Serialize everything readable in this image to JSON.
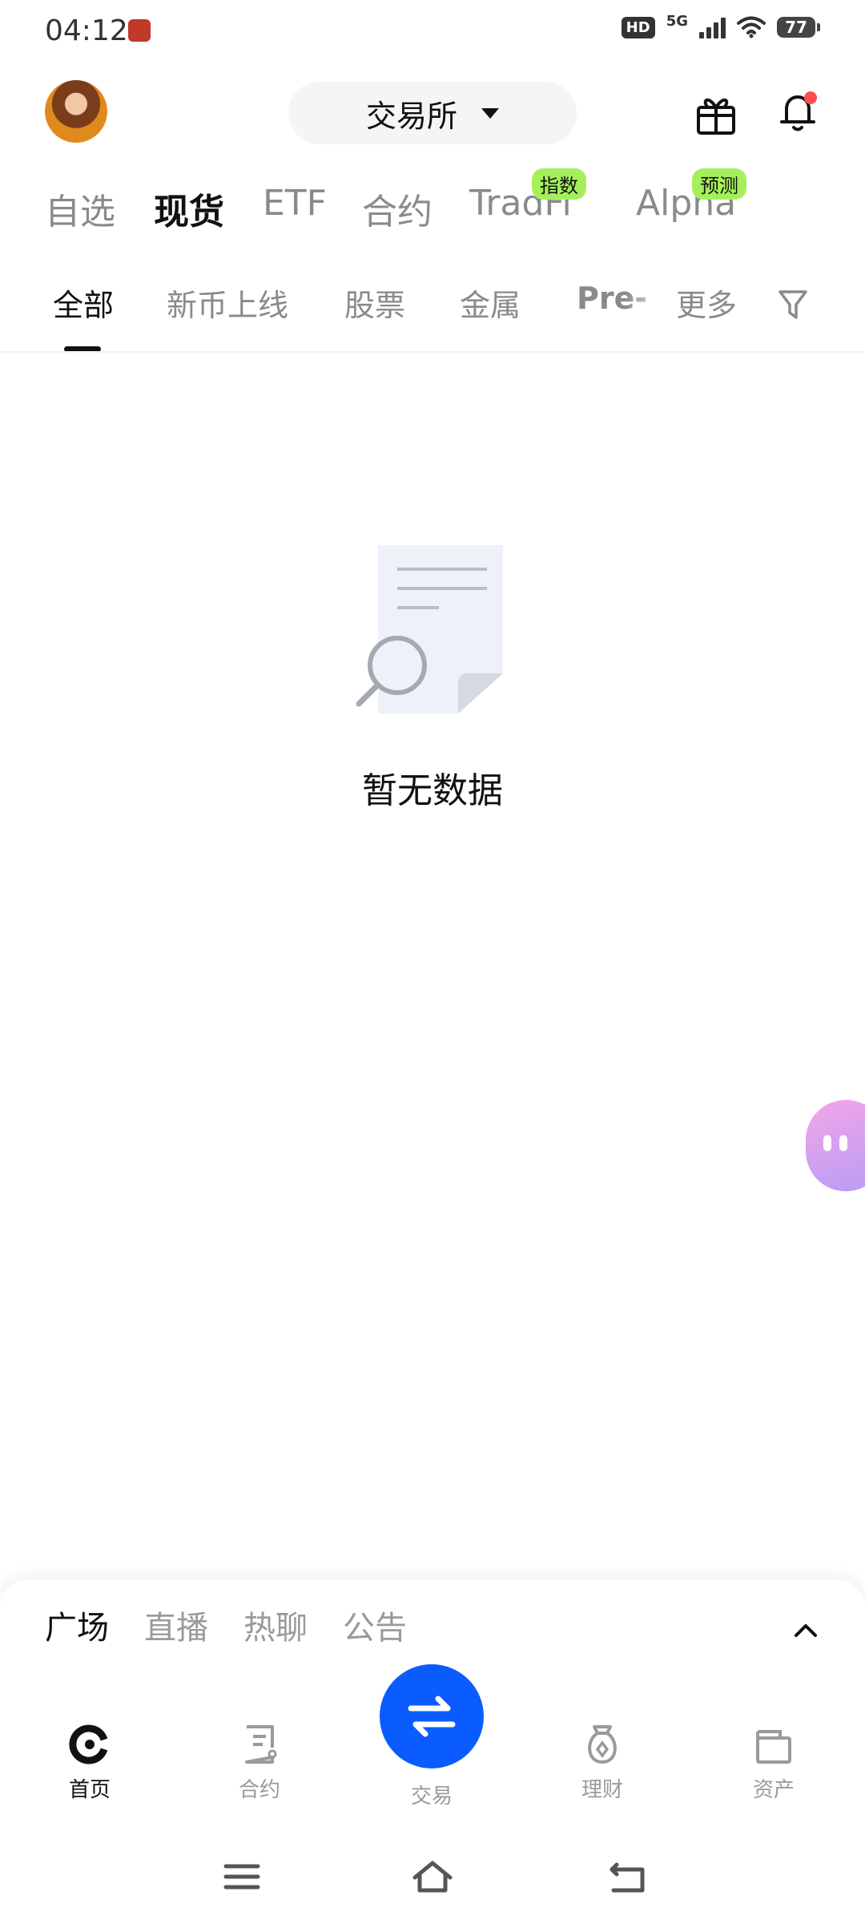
{
  "status_bar": {
    "time": "04:12",
    "hd": "HD",
    "network": "5G",
    "battery": "77"
  },
  "header": {
    "exchange_label": "交易所"
  },
  "main_tabs": [
    {
      "label": "自选",
      "badge": ""
    },
    {
      "label": "现货",
      "badge": "",
      "active": true
    },
    {
      "label": "ETF",
      "badge": ""
    },
    {
      "label": "合约",
      "badge": ""
    },
    {
      "label": "TradFi",
      "badge": "指数"
    },
    {
      "label": "Alpha",
      "badge": "预测"
    }
  ],
  "sub_tabs": [
    {
      "label": "全部",
      "active": true
    },
    {
      "label": "新币上线"
    },
    {
      "label": "股票"
    },
    {
      "label": "金属"
    },
    {
      "label": "Pre-M"
    },
    {
      "label": "更多"
    }
  ],
  "empty_state": {
    "text": "暂无数据"
  },
  "feed_tabs": [
    {
      "label": "广场",
      "active": true
    },
    {
      "label": "直播"
    },
    {
      "label": "热聊"
    },
    {
      "label": "公告"
    }
  ],
  "bottom_nav": [
    {
      "label": "首页",
      "icon": "home-icon",
      "active": true
    },
    {
      "label": "合约",
      "icon": "contract-icon"
    },
    {
      "label": "交易",
      "icon": "swap-icon"
    },
    {
      "label": "理财",
      "icon": "earn-icon"
    },
    {
      "label": "资产",
      "icon": "wallet-icon"
    }
  ],
  "colors": {
    "accent_blue": "#0a5cff",
    "badge_green": "#a5f05a",
    "notify_red": "#ff4d4f"
  }
}
